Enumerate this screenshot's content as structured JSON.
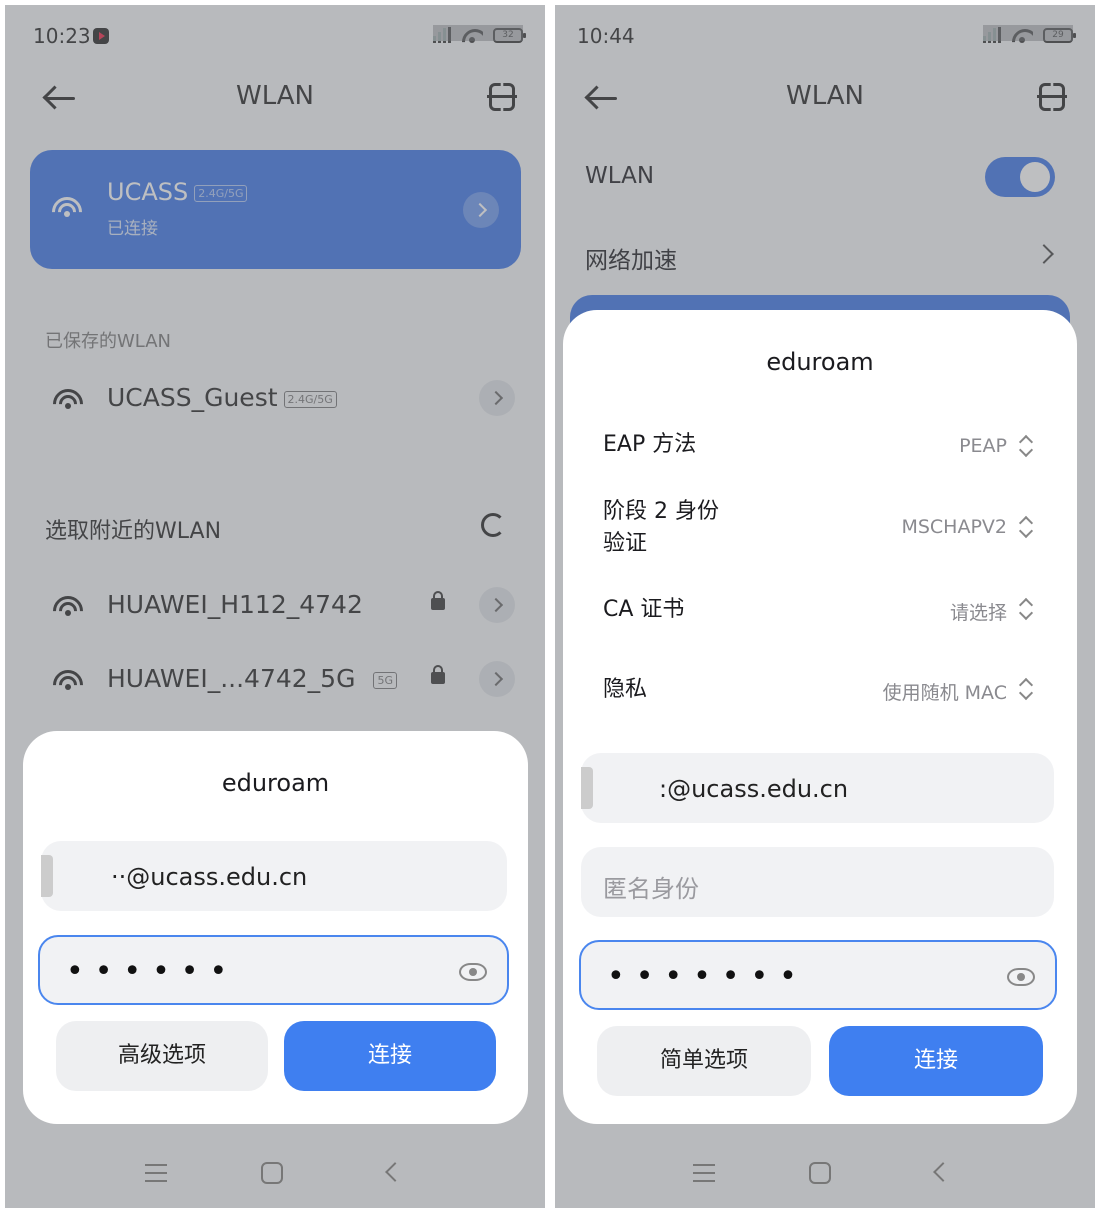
{
  "left": {
    "status": {
      "time": "10:23",
      "battery": "32"
    },
    "header": {
      "title": "WLAN"
    },
    "connected": {
      "ssid": "UCASS",
      "band": "2.4G/5G",
      "state": "已连接"
    },
    "saved_section": "已保存的WLAN",
    "saved": [
      {
        "ssid": "UCASS_Guest",
        "band": "2.4G/5G"
      }
    ],
    "nearby_section": "选取附近的WLAN",
    "nearby": [
      {
        "ssid": "HUAWEI_H112_4742",
        "band": ""
      },
      {
        "ssid": "HUAWEI_...4742_5G",
        "band": "5G"
      }
    ],
    "dialog": {
      "title": "eduroam",
      "identity": "··@ucass.edu.cn",
      "password_dots": "••••••",
      "advanced_button": "高级选项",
      "connect_button": "连接"
    }
  },
  "right": {
    "status": {
      "time": "10:44",
      "battery": "29"
    },
    "header": {
      "title": "WLAN"
    },
    "wlan_label": "WLAN",
    "wlan_toggle_on": true,
    "accel_label": "网络加速",
    "dialog": {
      "title": "eduroam",
      "options": [
        {
          "label": "EAP 方法",
          "value": "PEAP"
        },
        {
          "label": "阶段 2 身份验证",
          "value": "MSCHAPV2"
        },
        {
          "label": "CA 证书",
          "value": "请选择"
        },
        {
          "label": "隐私",
          "value": "使用随机 MAC"
        }
      ],
      "identity": ":@ucass.edu.cn",
      "anonymous_placeholder": "匿名身份",
      "password_dots": "•••••••",
      "simple_button": "简单选项",
      "connect_button": "连接"
    }
  },
  "colors": {
    "accent": "#3a74e8",
    "button_blue": "#3f7ff0"
  }
}
